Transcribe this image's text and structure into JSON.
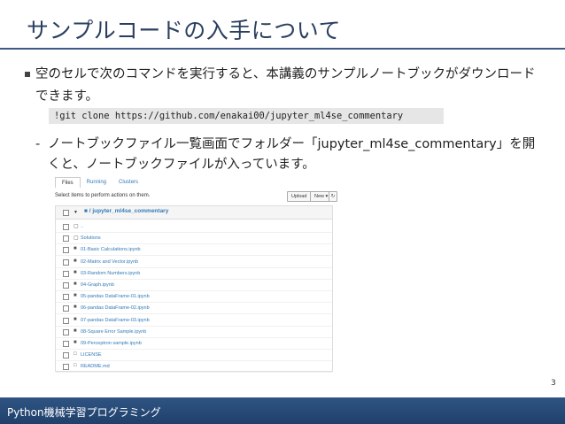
{
  "title": "サンプルコードの入手について",
  "bullet_text": "空のセルで次のコマンドを実行すると、本講義のサンプルノートブックがダウンロードできます。",
  "command": "!git clone https://github.com/enakai00/jupyter_ml4se_commentary",
  "sub_marker": "-",
  "sub_text": "ノートブックファイル一覧画面でフォルダー「jupyter_ml4se_commentary」を開くと、ノートブックファイルが入っています。",
  "screenshot": {
    "tabs": [
      "Files",
      "Running",
      "Clusters"
    ],
    "select_hint": "Select items to perform actions on them.",
    "upload_label": "Upload",
    "new_label": "New ▾",
    "refresh_glyph": "↻",
    "breadcrumb": "■ / jupyter_ml4se_commentary",
    "items": [
      {
        "icon": "▢",
        "name": ".."
      },
      {
        "icon": "▢",
        "name": "Solutions"
      },
      {
        "icon": "■",
        "name": "01-Basic Calculations.ipynb"
      },
      {
        "icon": "■",
        "name": "02-Matrix and Vector.ipynb"
      },
      {
        "icon": "■",
        "name": "03-Random Numbers.ipynb"
      },
      {
        "icon": "■",
        "name": "04-Graph.ipynb"
      },
      {
        "icon": "■",
        "name": "05-pandas DataFrame-01.ipynb"
      },
      {
        "icon": "■",
        "name": "06-pandas DataFrame-02.ipynb"
      },
      {
        "icon": "■",
        "name": "07-pandas DataFrame-03.ipynb"
      },
      {
        "icon": "■",
        "name": "08-Square Error Sample.ipynb"
      },
      {
        "icon": "■",
        "name": "09-Perceptron sample.ipynb"
      },
      {
        "icon": "□",
        "name": "LICENSE"
      },
      {
        "icon": "□",
        "name": "README.md"
      }
    ]
  },
  "page_number": "3",
  "footer": "Python機械学習プログラミング"
}
